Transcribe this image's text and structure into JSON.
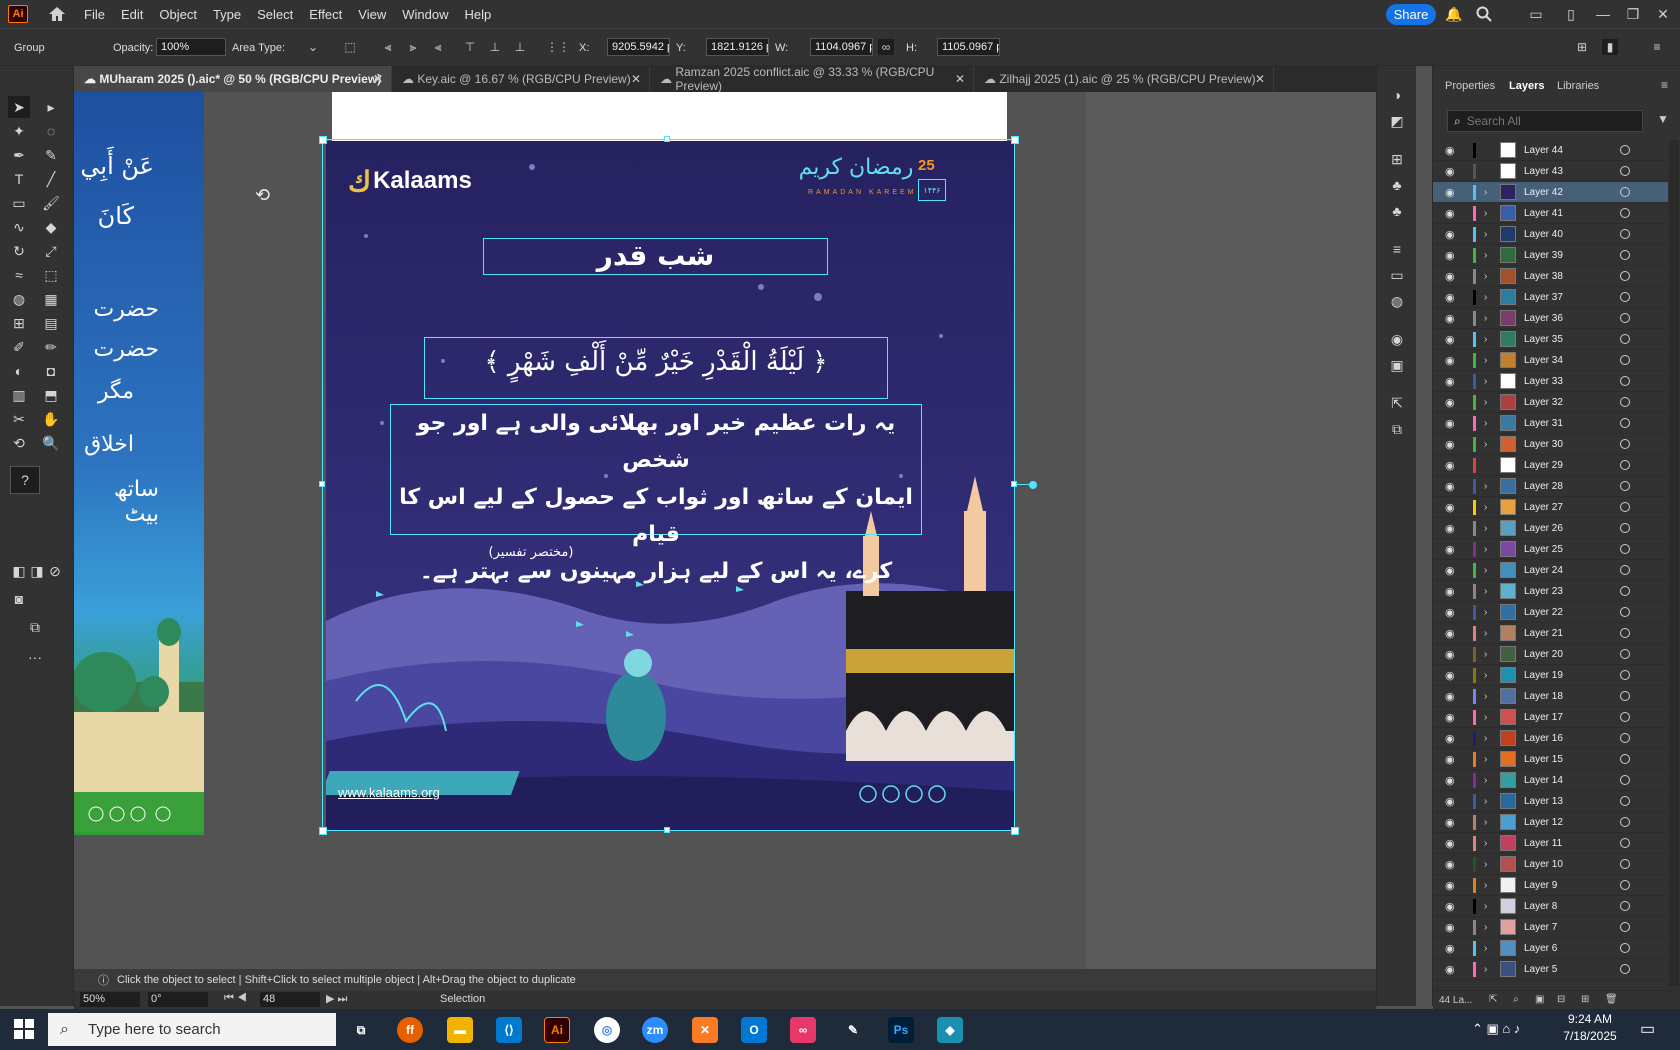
{
  "app": {
    "logo": "Ai"
  },
  "menu": [
    "File",
    "Edit",
    "Object",
    "Type",
    "Select",
    "Effect",
    "View",
    "Window",
    "Help"
  ],
  "share_label": "Share",
  "control": {
    "selection_type": "Group",
    "opacity_label": "Opacity:",
    "opacity_value": "100%",
    "area_type_label": "Area Type:",
    "x_label": "X:",
    "x_value": "9205.5942 p",
    "y_label": "Y:",
    "y_value": "1821.9126 p",
    "w_label": "W:",
    "w_value": "1104.0967 p",
    "h_label": "H:",
    "h_value": "1105.0967 p"
  },
  "tabs": [
    {
      "label": "MUharam 2025 ().aic* @ 50 % (RGB/CPU Preview)",
      "active": true
    },
    {
      "label": "Key.aic @ 16.67 % (RGB/CPU Preview)",
      "active": false
    },
    {
      "label": "Ramzan 2025 conflict.aic @ 33.33 % (RGB/CPU Preview)",
      "active": false
    },
    {
      "label": "Zilhajj 2025 (1).aic @ 25 % (RGB/CPU Preview)",
      "active": false
    }
  ],
  "left_artboard": {
    "lines": [
      "عَنْ أَبِي",
      "كَانَ",
      "حضرت",
      "حضرت",
      "مگر",
      "اخلاق",
      "ساتھ بیٹ"
    ]
  },
  "artboard": {
    "logo_text": "Kalaams",
    "ramadan_badge": "رمضان کریم",
    "ramadan_number": "25",
    "ramadan_sub": "RAMADAN KAREEM",
    "ramadan_year": "۱۴۴۶",
    "title": "شب قدر",
    "ayah": "﴿ لَيْلَةُ الْقَدْرِ خَيْرٌ مِّنْ أَلْفِ شَهْرٍ ﴾",
    "body_lines": [
      "یہ رات عظیم خیر اور بھلائی والی ہے اور جو شخص",
      "ایمان کے ساتھ اور ثواب کے حصول کے لیے اس کا قیام",
      "کرے، یہ اس کے لیے ہزار مہینوں سے بہتر ہے۔"
    ],
    "source": "(مختصر تفسیر)",
    "website": "www.kalaams.org"
  },
  "status": {
    "hint": "Click the object to select  |  Shift+Click to select multiple object  |  Alt+Drag the object to duplicate",
    "zoom": "50%",
    "rotation": "0°",
    "artboard_num": "48",
    "tool": "Selection"
  },
  "panel": {
    "tabs": [
      "Properties",
      "Layers",
      "Libraries"
    ],
    "search_placeholder": "Search All",
    "footer_count": "44 La...",
    "layers": [
      {
        "name": "Layer 44",
        "color": "#000000",
        "thumb": "#ffffff",
        "expand": false
      },
      {
        "name": "Layer 43",
        "color": "#555555",
        "thumb": "#ffffff",
        "expand": false
      },
      {
        "name": "Layer 42",
        "color": "#4fc3f7",
        "thumb": "#2a2561",
        "expand": true,
        "selected": true
      },
      {
        "name": "Layer 41",
        "color": "#ff69b4",
        "thumb": "#3b5ea8",
        "expand": true
      },
      {
        "name": "Layer 40",
        "color": "#4fc3f7",
        "thumb": "#1f3a6b",
        "expand": true
      },
      {
        "name": "Layer 39",
        "color": "#3cba3c",
        "thumb": "#2f6b3e",
        "expand": true
      },
      {
        "name": "Layer 38",
        "color": "#888888",
        "thumb": "#a0522d",
        "expand": true
      },
      {
        "name": "Layer 37",
        "color": "#000000",
        "thumb": "#2e7d9e",
        "expand": true
      },
      {
        "name": "Layer 36",
        "color": "#888888",
        "thumb": "#7a3d6b",
        "expand": true
      },
      {
        "name": "Layer 35",
        "color": "#4fc3f7",
        "thumb": "#2f7d60",
        "expand": true
      },
      {
        "name": "Layer 34",
        "color": "#3cba3c",
        "thumb": "#c08030",
        "expand": true
      },
      {
        "name": "Layer 33",
        "color": "#3b5ba8",
        "thumb": "#ffffff",
        "expand": true
      },
      {
        "name": "Layer 32",
        "color": "#3cba3c",
        "thumb": "#b04040",
        "expand": true
      },
      {
        "name": "Layer 31",
        "color": "#ff69b4",
        "thumb": "#3a7a9e",
        "expand": true
      },
      {
        "name": "Layer 30",
        "color": "#3cba3c",
        "thumb": "#d06030",
        "expand": true
      },
      {
        "name": "Layer 29",
        "color": "#e04040",
        "thumb": "#ffffff",
        "expand": false
      },
      {
        "name": "Layer 28",
        "color": "#3b5ba8",
        "thumb": "#3a6ea0",
        "expand": true
      },
      {
        "name": "Layer 27",
        "color": "#f0d000",
        "thumb": "#e8a040",
        "expand": true
      },
      {
        "name": "Layer 26",
        "color": "#888888",
        "thumb": "#5aa0c0",
        "expand": true
      },
      {
        "name": "Layer 25",
        "color": "#8a2a9a",
        "thumb": "#7a4aa0",
        "expand": true
      },
      {
        "name": "Layer 24",
        "color": "#3cba3c",
        "thumb": "#4090c0",
        "expand": true
      },
      {
        "name": "Layer 23",
        "color": "#888888",
        "thumb": "#60b0d0",
        "expand": true
      },
      {
        "name": "Layer 22",
        "color": "#3b5ba8",
        "thumb": "#3070a0",
        "expand": true
      },
      {
        "name": "Layer 21",
        "color": "#e08080",
        "thumb": "#b08060",
        "expand": true
      },
      {
        "name": "Layer 20",
        "color": "#8b5a2b",
        "thumb": "#406040",
        "expand": true
      },
      {
        "name": "Layer 19",
        "color": "#8a7a00",
        "thumb": "#2090b0",
        "expand": true
      },
      {
        "name": "Layer 18",
        "color": "#8080ff",
        "thumb": "#5070a0",
        "expand": true
      },
      {
        "name": "Layer 17",
        "color": "#ff69b4",
        "thumb": "#d05050",
        "expand": true
      },
      {
        "name": "Layer 16",
        "color": "#1a1a8a",
        "thumb": "#c04020",
        "expand": true
      },
      {
        "name": "Layer 15",
        "color": "#e08020",
        "thumb": "#e07020",
        "expand": true
      },
      {
        "name": "Layer 14",
        "color": "#8a2a9a",
        "thumb": "#30a0a0",
        "expand": true
      },
      {
        "name": "Layer 13",
        "color": "#3b5ba8",
        "thumb": "#2a6a9a",
        "expand": true
      },
      {
        "name": "Layer 12",
        "color": "#c08060",
        "thumb": "#4aa0d0",
        "expand": true
      },
      {
        "name": "Layer 11",
        "color": "#e08080",
        "thumb": "#c04060",
        "expand": true
      },
      {
        "name": "Layer 10",
        "color": "#1a5a2a",
        "thumb": "#b05050",
        "expand": true
      },
      {
        "name": "Layer 9",
        "color": "#e08020",
        "thumb": "#f0f0f0",
        "expand": true
      },
      {
        "name": "Layer 8",
        "color": "#000000",
        "thumb": "#d0d0e0",
        "expand": true
      },
      {
        "name": "Layer 7",
        "color": "#888888",
        "thumb": "#e0a0a0",
        "expand": true
      },
      {
        "name": "Layer 6",
        "color": "#4fc3f7",
        "thumb": "#5090c0",
        "expand": true
      },
      {
        "name": "Layer 5",
        "color": "#ff69b4",
        "thumb": "#3a5080",
        "expand": true
      }
    ]
  },
  "taskbar": {
    "search_placeholder": "Type here to search",
    "time": "9:24 AM",
    "date": "7/18/2025"
  }
}
